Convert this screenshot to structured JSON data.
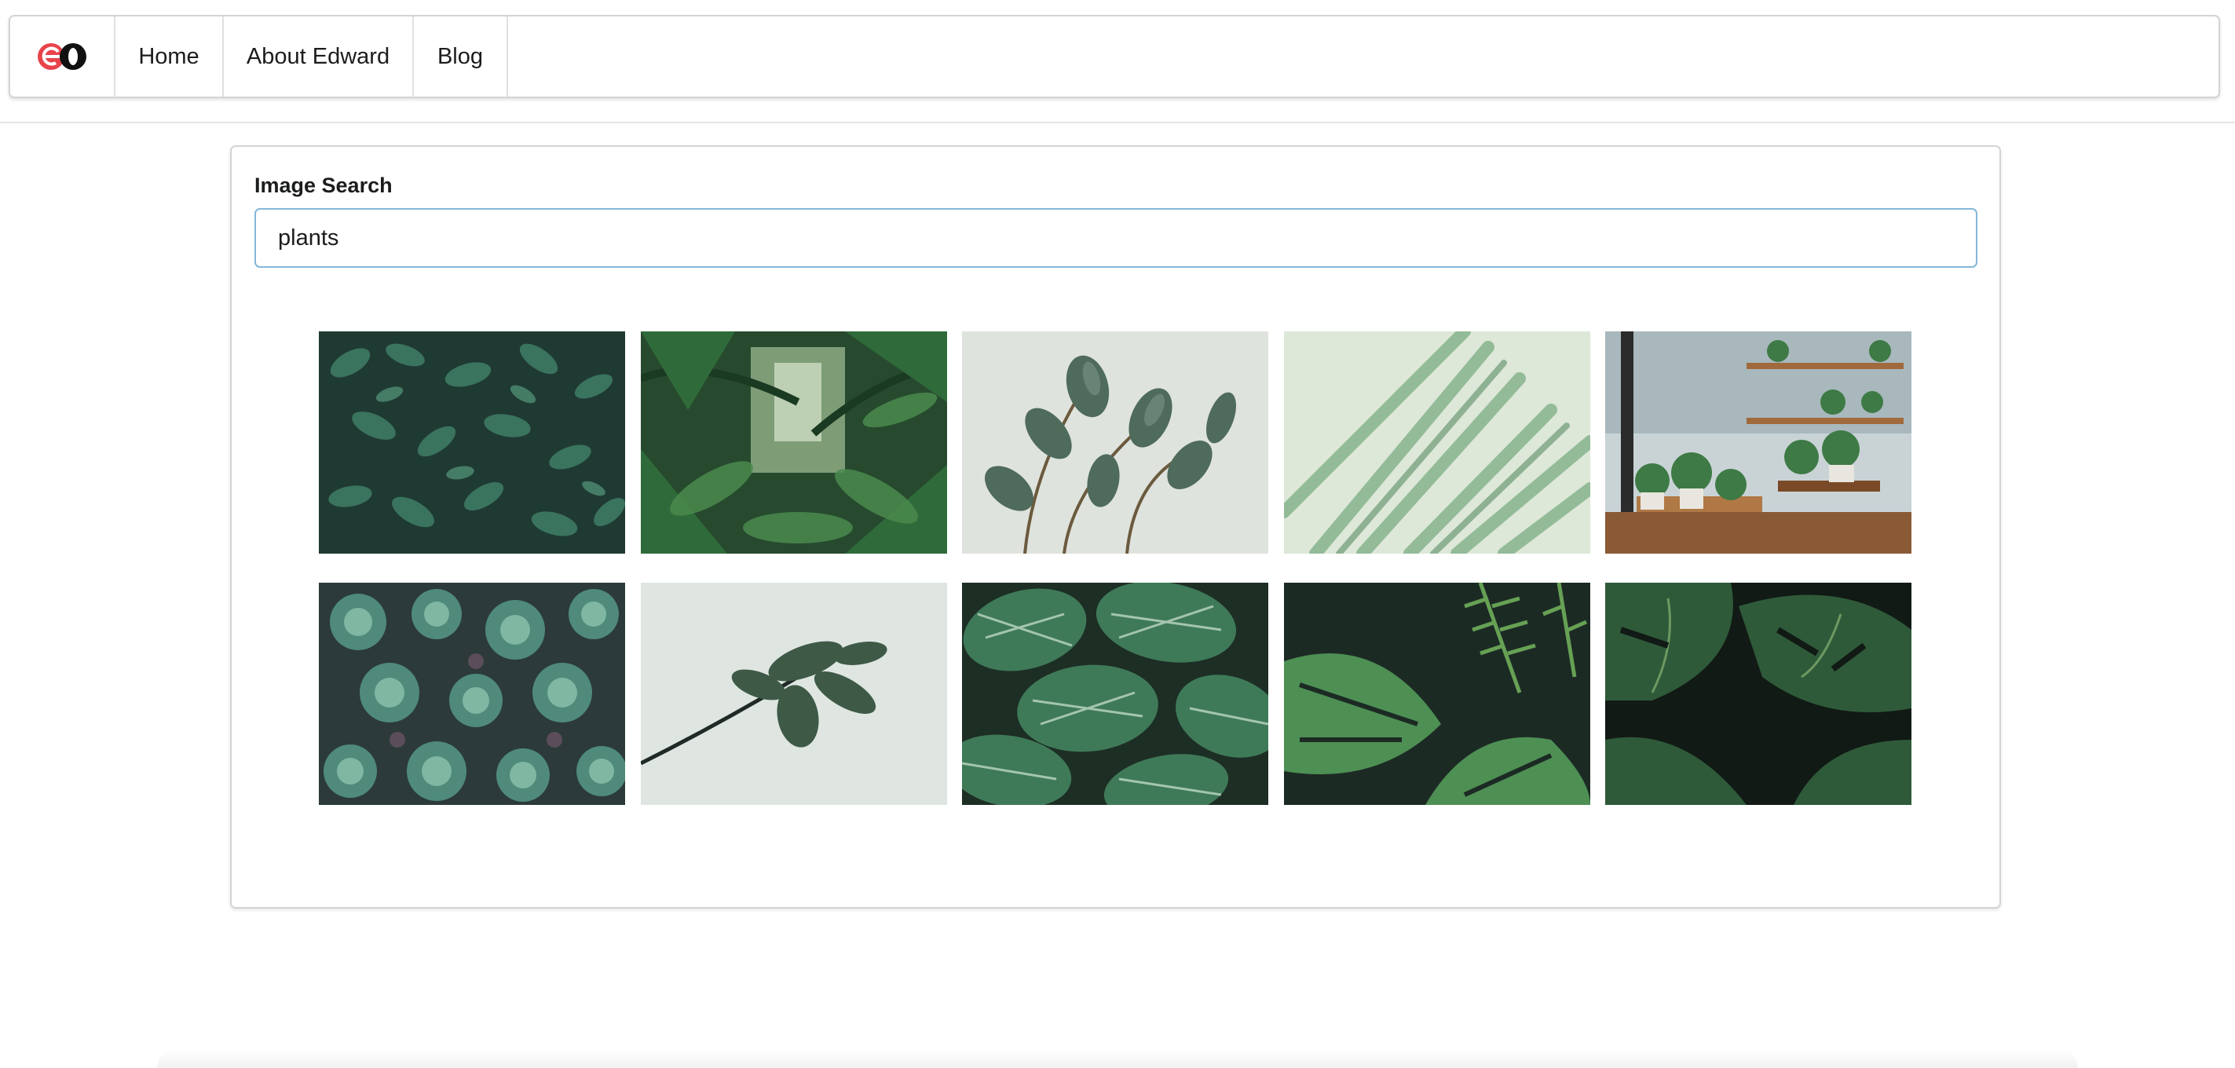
{
  "nav": {
    "logo_text": "eo",
    "items": [
      {
        "label": "Home"
      },
      {
        "label": "About Edward"
      },
      {
        "label": "Blog"
      }
    ]
  },
  "image_search": {
    "label": "Image Search",
    "query": "plants"
  },
  "results": {
    "images": [
      {
        "icon": "dense-green-leaves-image"
      },
      {
        "icon": "jungle-palms-image"
      },
      {
        "icon": "rubber-plant-image"
      },
      {
        "icon": "blurred-palm-frond-image"
      },
      {
        "icon": "plant-shop-shelves-image"
      },
      {
        "icon": "succulents-image"
      },
      {
        "icon": "single-branch-leaves-image"
      },
      {
        "icon": "striped-calathea-leaves-image"
      },
      {
        "icon": "monstera-and-fern-image"
      },
      {
        "icon": "dark-monstera-leaves-image"
      }
    ]
  },
  "colors": {
    "logo_red": "#e8434b",
    "logo_black": "#111111",
    "input_focus_border": "#85b7d9",
    "border": "#d4d4d5"
  }
}
